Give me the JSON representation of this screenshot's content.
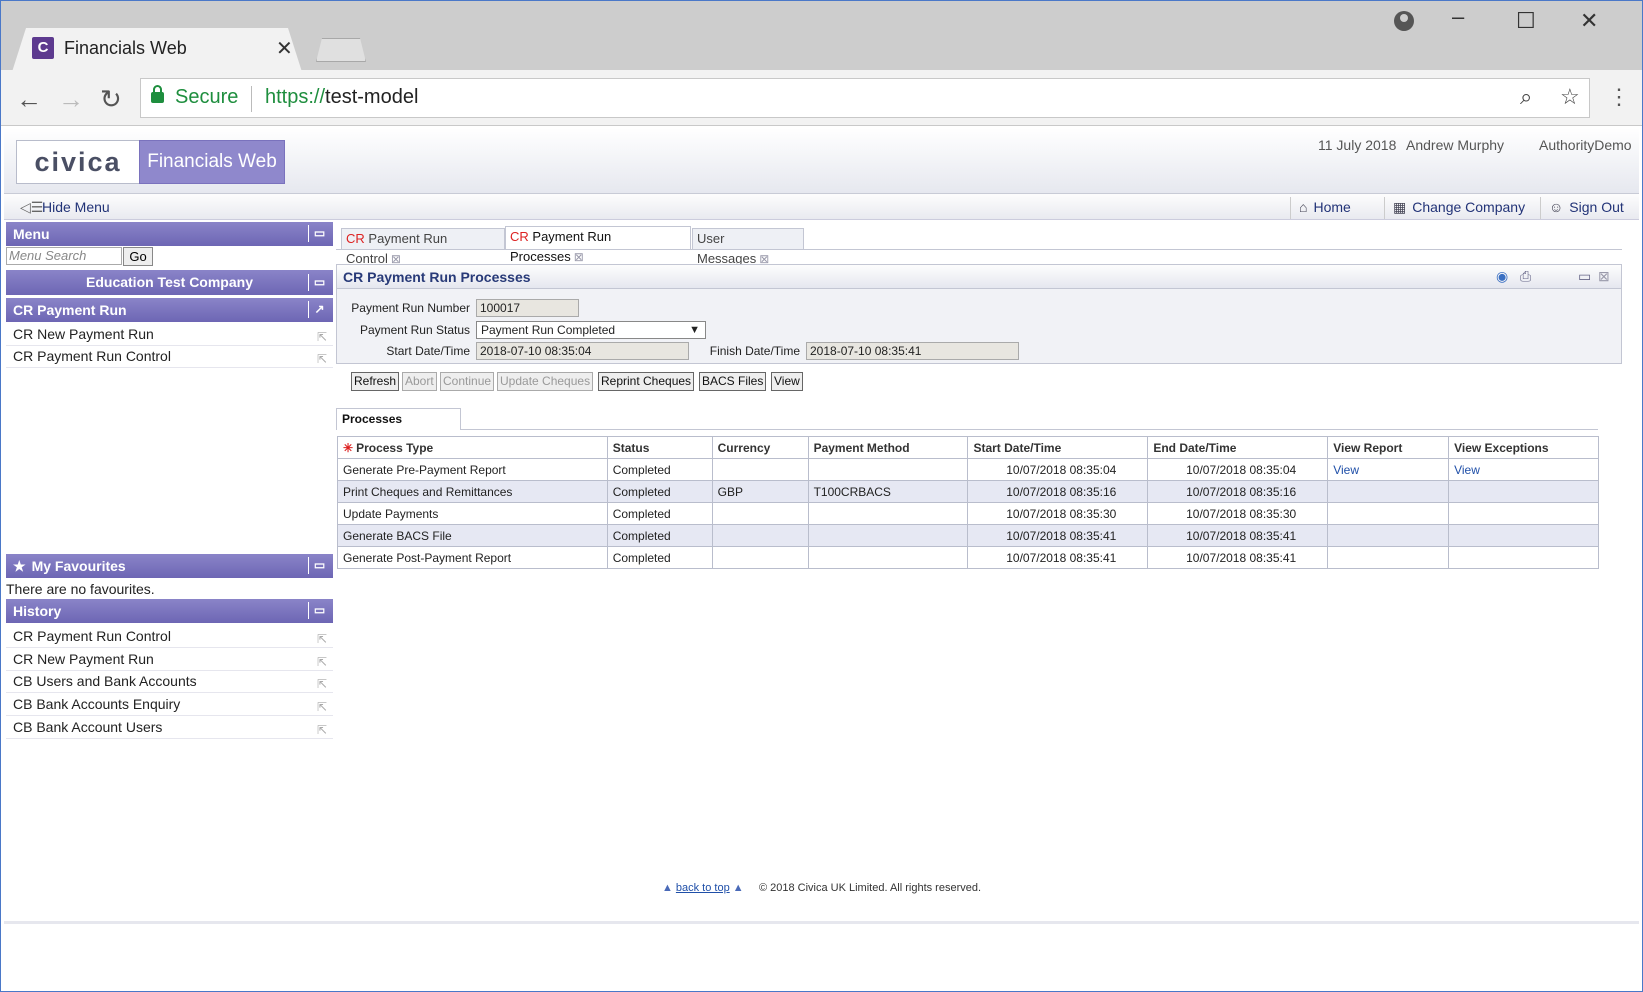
{
  "browser": {
    "tab_title": "Financials Web",
    "tab_favicon": "C",
    "security_label": "Secure",
    "url_scheme": "https://",
    "url_host": "test-model"
  },
  "header": {
    "logo_civica": "civica",
    "logo_product": "Financials Web",
    "date": "11 July 2018",
    "user": "Andrew Murphy",
    "authority": "AuthorityDemo"
  },
  "navbar": {
    "hide_menu": "Hide Menu",
    "home": "Home",
    "change_company": "Change Company",
    "sign_out": "Sign Out"
  },
  "menu": {
    "title": "Menu",
    "search_placeholder": "Menu Search",
    "go": "Go",
    "company": "Education Test Company",
    "section": "CR Payment Run",
    "items": [
      "CR New Payment Run",
      "CR Payment Run Control"
    ]
  },
  "favourites": {
    "title": "My Favourites",
    "empty": "There are no favourites."
  },
  "history": {
    "title": "History",
    "items": [
      "CR Payment Run Control",
      "CR New Payment Run",
      "CB Users and Bank Accounts",
      "CB Bank Accounts Enquiry",
      "CB Bank Account Users"
    ]
  },
  "tabs": [
    {
      "prefix": "CR",
      "label": "Payment Run Control"
    },
    {
      "prefix": "CR",
      "label": "Payment Run Processes"
    },
    {
      "prefix": "",
      "label": "User Messages"
    }
  ],
  "form": {
    "title": "CR Payment Run Processes",
    "run_number_label": "Payment Run Number",
    "run_number": "100017",
    "status_label": "Payment Run Status",
    "status": "Payment Run Completed",
    "start_label": "Start Date/Time",
    "start": "2018-07-10 08:35:04",
    "finish_label": "Finish Date/Time",
    "finish": "2018-07-10 08:35:41"
  },
  "actions": [
    "Refresh",
    "Abort",
    "Continue",
    "Update Cheques",
    "Reprint Cheques",
    "BACS Files",
    "View"
  ],
  "processes_tab": "Processes",
  "grid": {
    "columns": [
      "Process Type",
      "Status",
      "Currency",
      "Payment Method",
      "Start Date/Time",
      "End Date/Time",
      "View Report",
      "View Exceptions"
    ],
    "rows": [
      [
        "Generate Pre-Payment Report",
        "Completed",
        "",
        "",
        "10/07/2018 08:35:04",
        "10/07/2018 08:35:04",
        "View",
        "View"
      ],
      [
        "Print Cheques and Remittances",
        "Completed",
        "GBP",
        "T100CRBACS",
        "10/07/2018 08:35:16",
        "10/07/2018 08:35:16",
        "",
        ""
      ],
      [
        "Update Payments",
        "Completed",
        "",
        "",
        "10/07/2018 08:35:30",
        "10/07/2018 08:35:30",
        "",
        ""
      ],
      [
        "Generate BACS File",
        "Completed",
        "",
        "",
        "10/07/2018 08:35:41",
        "10/07/2018 08:35:41",
        "",
        ""
      ],
      [
        "Generate Post-Payment Report",
        "Completed",
        "",
        "",
        "10/07/2018 08:35:41",
        "10/07/2018 08:35:41",
        "",
        ""
      ]
    ]
  },
  "footer": {
    "back_to_top": "back to top",
    "copyright": "© 2018 Civica UK Limited. All rights reserved."
  }
}
